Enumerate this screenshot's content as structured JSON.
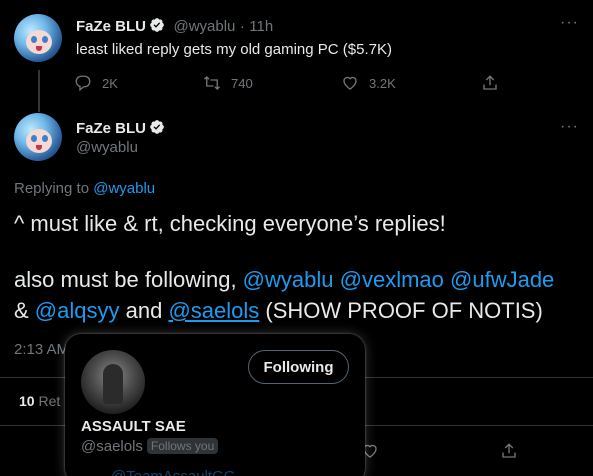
{
  "tweet1": {
    "name": "FaZe BLU",
    "handle": "@wyablu",
    "sep": "·",
    "time": "11h",
    "text": "least liked reply gets my old gaming PC ($5.7K)",
    "reply_count": "2K",
    "retweet_count": "740",
    "like_count": "3.2K"
  },
  "tweet2": {
    "name": "FaZe BLU",
    "handle": "@wyablu",
    "replying_prefix": "Replying to ",
    "replying_handle": "@wyablu",
    "line1": "^ must like & rt, checking everyone’s replies!",
    "line2_prefix": "also must be following, ",
    "mention1": "@wyablu",
    "mention2": "@vexlmao",
    "mention3": "@ufwJade",
    "amp": "& ",
    "mention4": "@alqsyy",
    "and_text": " and ",
    "mention5": "@saelols",
    "suffix": " (SHOW PROOF OF NOTIS)",
    "time_partial": "2:13 AM",
    "stats_count": "10",
    "stats_partial": "Ret"
  },
  "hover_card": {
    "name": "ASSAULT SAE",
    "handle": "@saelols",
    "follows_you": "Follows you",
    "follow_button": "Following",
    "partial_bottom": "@TeamAssaultGG"
  },
  "icons": [
    "verified-badge-icon",
    "more-icon",
    "reply-icon",
    "retweet-icon",
    "like-icon",
    "share-icon"
  ],
  "colors": {
    "background": "#000000",
    "text": "#e7e9ea",
    "muted": "#71767b",
    "link": "#1d9bf0",
    "verified": "#e7e9ea"
  }
}
